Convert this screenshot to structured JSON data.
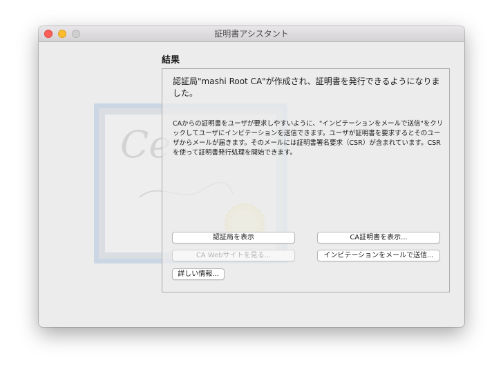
{
  "window": {
    "title": "証明書アシスタント"
  },
  "result": {
    "heading": "結果",
    "message": "認証局\"mashi Root CA\"が作成され、証明書を発行できるようになりました。",
    "info": "CAからの証明書をユーザが要求しやすいように、\"インビテーションをメールで送信\"をクリックしてユーザにインビテーションを送信できます。ユーザが証明書を要求するとそのユーザからメールが届きます。そのメールには証明書署名要求（CSR）が含まれています。CSRを使って証明書発行処理を開始できます。"
  },
  "buttons": {
    "show_ca": "認証局を表示",
    "show_ca_cert": "CA証明書を表示...",
    "ca_website": "CA Webサイトを見る...",
    "email_invitation": "インビテーションをメールで送信...",
    "more_info": "詳しい情報..."
  }
}
